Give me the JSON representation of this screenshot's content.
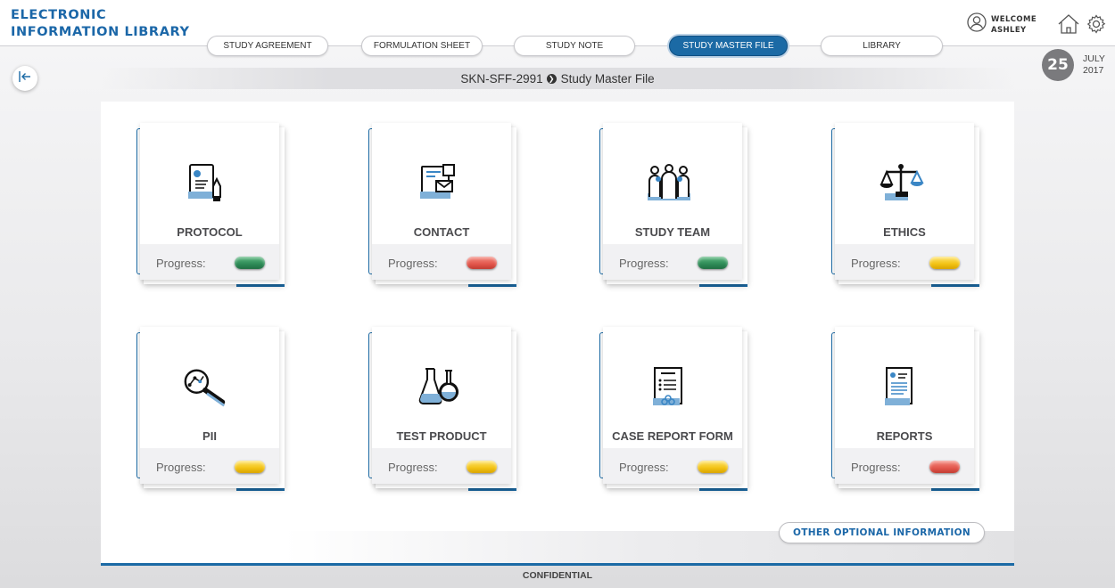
{
  "app": {
    "title_line1": "ELECTRONIC",
    "title_line2": "INFORMATION LIBRARY"
  },
  "tabs": [
    {
      "label": "STUDY AGREEMENT",
      "active": false
    },
    {
      "label": "FORMULATION SHEET",
      "active": false
    },
    {
      "label": "STUDY NOTE",
      "active": false
    },
    {
      "label": "STUDY MASTER FILE",
      "active": true
    },
    {
      "label": "LIBRARY",
      "active": false
    }
  ],
  "user": {
    "welcome": "WELCOME",
    "name": "ASHLEY"
  },
  "date": {
    "day": "25",
    "month": "JULY",
    "year": "2017"
  },
  "breadcrumb": {
    "study_id": "SKN-SFF-2991",
    "page": "Study Master File"
  },
  "colors": {
    "accent": "#1b6aa5",
    "green": "#2e8b57",
    "red": "#e2574c",
    "yellow": "#f2c214"
  },
  "cards": [
    {
      "title": "PROTOCOL",
      "icon": "protocol-document-icon",
      "progress_label": "Progress:",
      "status": "green"
    },
    {
      "title": "CONTACT",
      "icon": "contact-icon",
      "progress_label": "Progress:",
      "status": "red"
    },
    {
      "title": "STUDY TEAM",
      "icon": "team-icon",
      "progress_label": "Progress:",
      "status": "green"
    },
    {
      "title": "ETHICS",
      "icon": "scales-icon",
      "progress_label": "Progress:",
      "status": "yellow"
    },
    {
      "title": "PII",
      "icon": "magnifier-icon",
      "progress_label": "Progress:",
      "status": "yellow"
    },
    {
      "title": "TEST PRODUCT",
      "icon": "flasks-icon",
      "progress_label": "Progress:",
      "status": "yellow"
    },
    {
      "title": "CASE REPORT FORM",
      "icon": "clipboard-icon",
      "progress_label": "Progress:",
      "status": "yellow"
    },
    {
      "title": "REPORTS",
      "icon": "report-icon",
      "progress_label": "Progress:",
      "status": "red"
    }
  ],
  "other_info_label": "OTHER OPTIONAL INFORMATION",
  "footer": {
    "confidential": "CONFIDENTIAL"
  }
}
